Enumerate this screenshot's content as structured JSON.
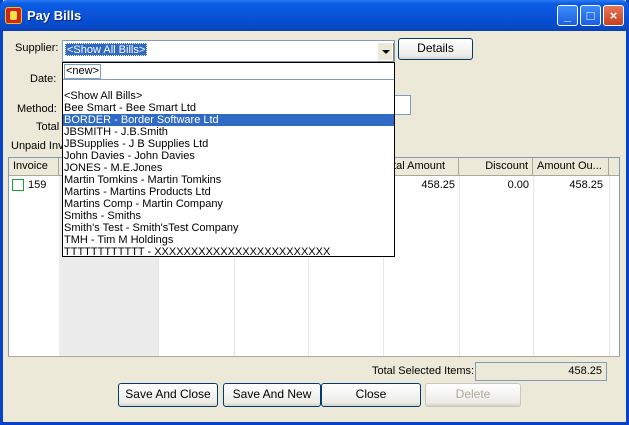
{
  "window": {
    "title": "Pay Bills"
  },
  "supplier": {
    "label": "Supplier:",
    "value": "<Show All Bills>",
    "details_button": "Details"
  },
  "date": {
    "label": "Date:"
  },
  "method": {
    "label": "Method:"
  },
  "total": {
    "label": "Total"
  },
  "unpaid": {
    "label": "Unpaid Inv"
  },
  "dropdown": {
    "new_item": "<new>",
    "items": [
      "<Show All Bills>",
      "Bee Smart - Bee Smart Ltd",
      "BORDER - Border Software Ltd",
      "JBSMITH - J.B.Smith",
      "JBSupplies - J B Supplies Ltd",
      "John Davies - John Davies",
      "JONES - M.E.Jones",
      "Martin Tomkins - Martin Tomkins",
      "Martins - Martins Products Ltd",
      "Martins Comp - Martin Company",
      "Smiths - Smiths",
      "Smith's Test - Smith'sTest Company",
      "TMH - Tim M Holdings",
      "TTTTTTTTTTTT - XXXXXXXXXXXXXXXXXXXXXXXX"
    ],
    "selected_index": 2
  },
  "grid": {
    "columns": [
      "Invoice",
      "",
      "",
      "",
      "",
      "otal Amount",
      "Discount",
      "Amount Ou..."
    ],
    "rows": [
      {
        "invoice": "159",
        "total_amount": "458.25",
        "discount": "0.00",
        "amount_outstanding": "458.25"
      }
    ]
  },
  "footer": {
    "total_selected_label": "Total Selected Items:",
    "total_selected_value": "458.25"
  },
  "buttons": {
    "save_and_close": "Save And Close",
    "save_and_new": "Save And New",
    "close": "Close",
    "delete": "Delete"
  }
}
